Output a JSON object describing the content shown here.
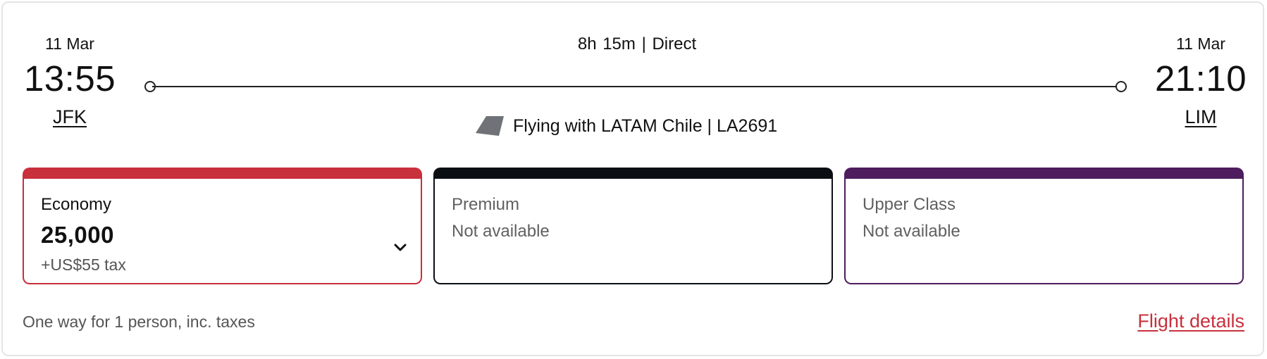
{
  "flight": {
    "departure": {
      "date": "11 Mar",
      "time": "13:55",
      "airport": "JFK"
    },
    "arrival": {
      "date": "11 Mar",
      "time": "21:10",
      "airport": "LIM"
    },
    "summary": "8h 15m  |  Direct",
    "operator_text": "Flying with LATAM Chile | LA2691",
    "operator_icon": "airline-tail-logo-icon"
  },
  "fares": {
    "economy": {
      "name": "Economy",
      "points": "25,000",
      "tax": "+US$55 tax",
      "color": "#c8303c",
      "icon": "chevron-down-icon"
    },
    "premium": {
      "name": "Premium",
      "status": "Not available",
      "color": "#0b0f14"
    },
    "upper": {
      "name": "Upper Class",
      "status": "Not available",
      "color": "#4d1d5e"
    }
  },
  "footer": {
    "note": "One way for 1 person, inc. taxes",
    "details_link": "Flight details",
    "link_color": "#c8303c"
  }
}
